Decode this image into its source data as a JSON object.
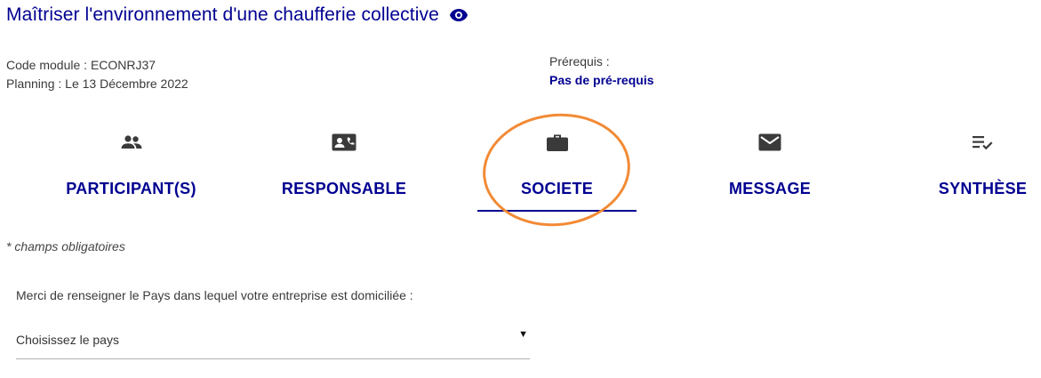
{
  "header": {
    "title": "Maîtriser l'environnement d'une chaufferie collective",
    "view_icon": "eye-icon"
  },
  "meta": {
    "code_module": "Code module : ECONRJ37",
    "planning": "Planning : Le 13 Décembre 2022",
    "prerequis_label": "Prérequis :",
    "prerequis_value": "Pas de pré-requis"
  },
  "tabs": [
    {
      "label": "PARTICIPANT(S)",
      "icon": "people-icon",
      "active": false
    },
    {
      "label": "RESPONSABLE",
      "icon": "contact-card-icon",
      "active": false
    },
    {
      "label": "SOCIETE",
      "icon": "briefcase-icon",
      "active": true
    },
    {
      "label": "MESSAGE",
      "icon": "envelope-icon",
      "active": false
    },
    {
      "label": "SYNTHÈSE",
      "icon": "checklist-icon",
      "active": false
    }
  ],
  "form": {
    "required_note": "* champs obligatoires",
    "country_question": "Merci de renseigner le Pays dans lequel votre entreprise est domiciliée :",
    "country_select_value": "Choisissez le pays",
    "dropdown_arrow": "▼"
  },
  "colors": {
    "primary": "#000091",
    "annotation": "#f28a35",
    "icon": "#3a3a3a"
  }
}
